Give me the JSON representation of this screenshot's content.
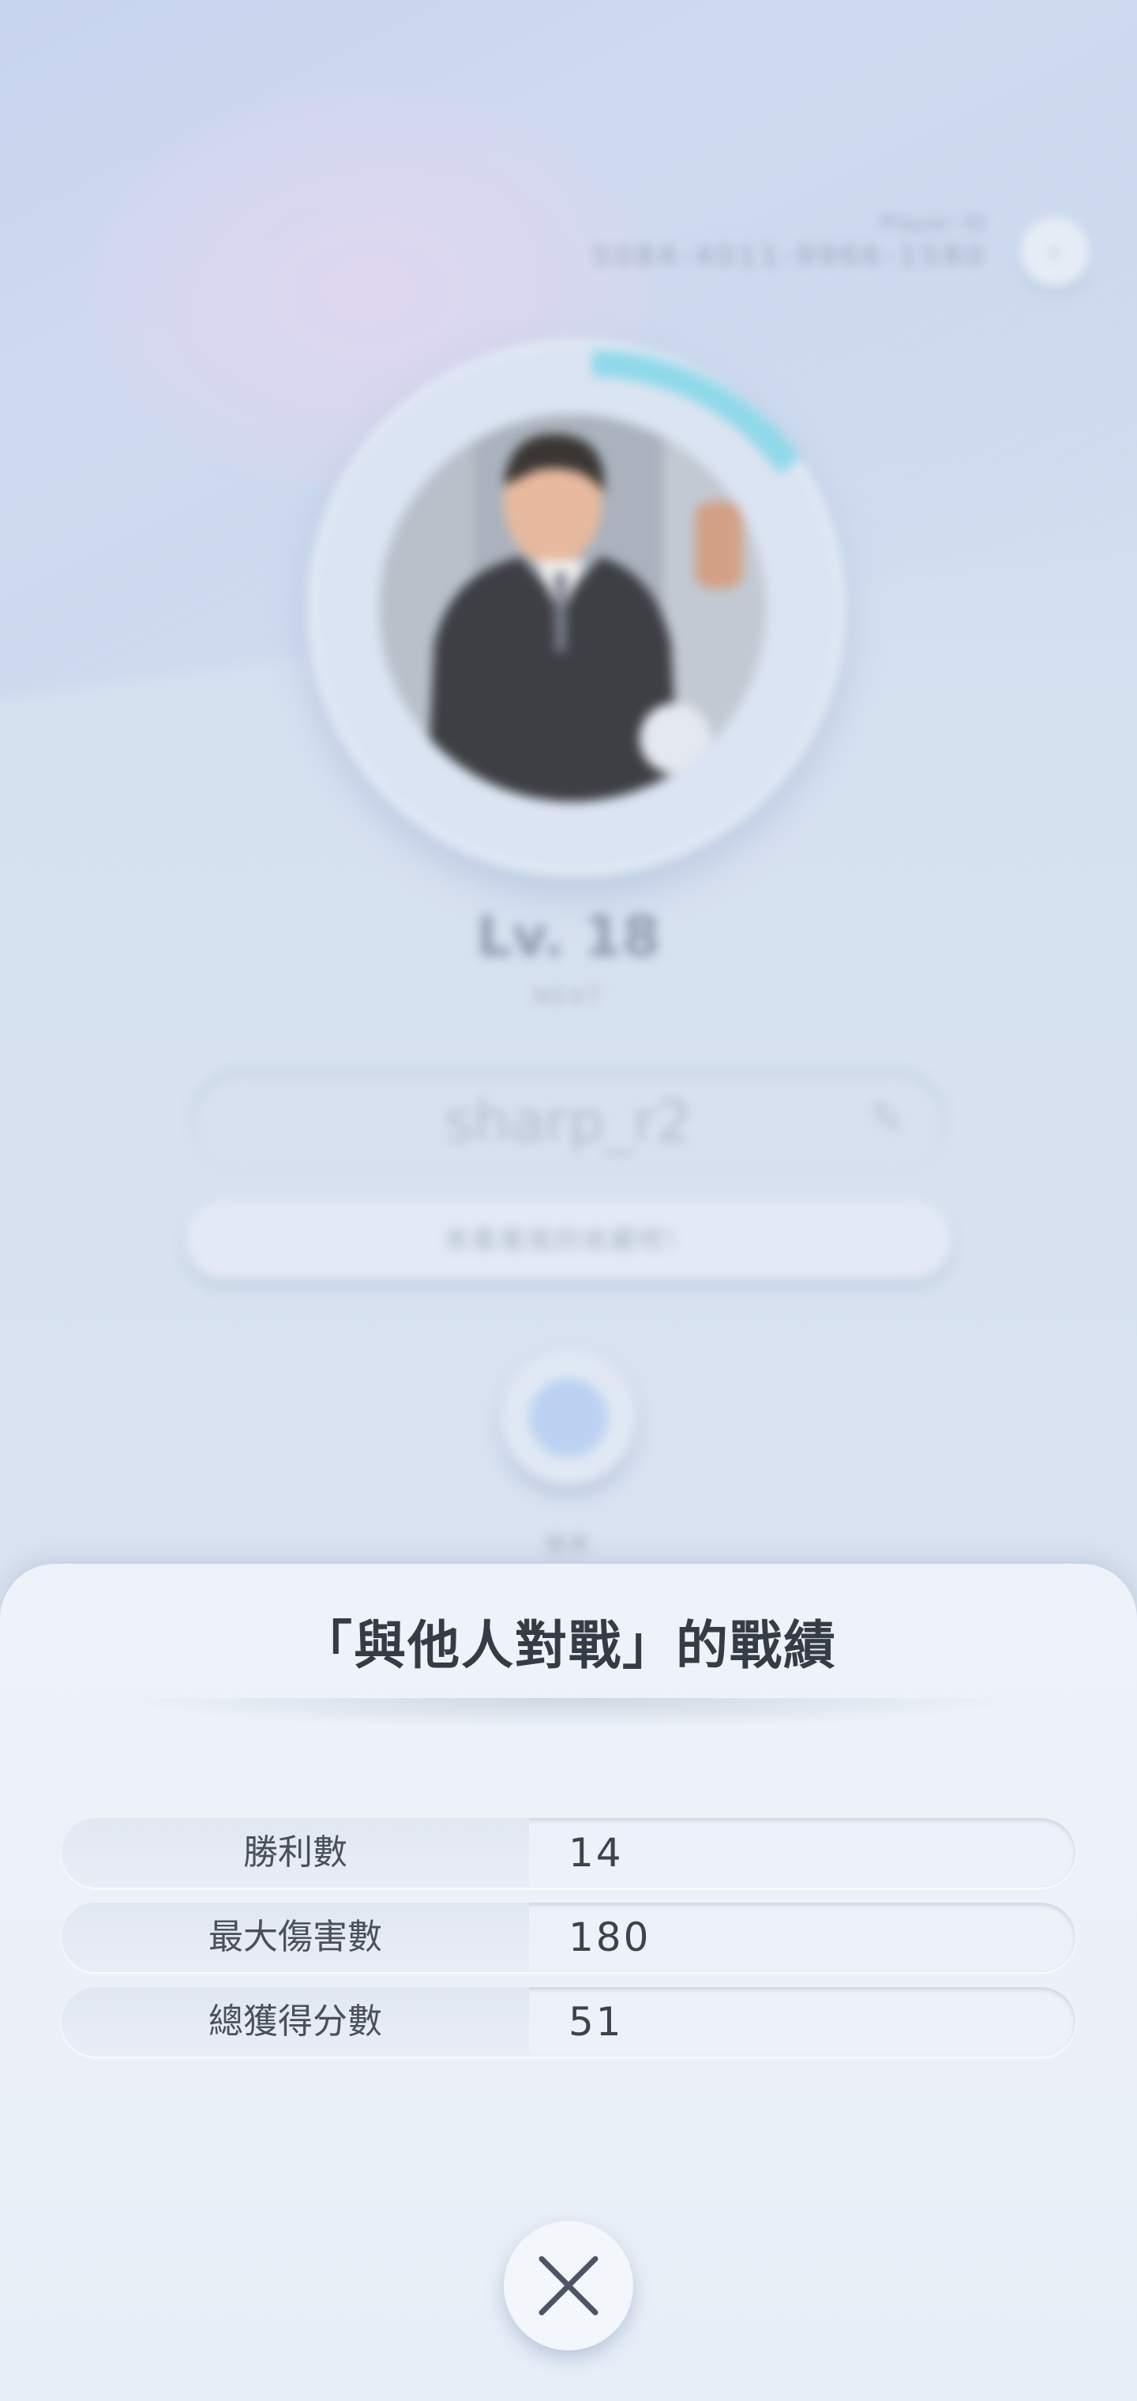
{
  "background": {
    "player_id_label": "Player ID",
    "player_id": "5084-4011-9966-1580",
    "level": "Lv. 18",
    "level_sub": "NEXT",
    "username": "sharp_r2",
    "message": "來看看我的收藏吧！",
    "badge_label": "徽章"
  },
  "modal": {
    "title": "「與他人對戰」的戰績",
    "stats": [
      {
        "label": "勝利數",
        "value": "14"
      },
      {
        "label": "最大傷害數",
        "value": "180"
      },
      {
        "label": "總獲得分數",
        "value": "51"
      }
    ]
  },
  "colors": {
    "ring_progress": "#8fd9ea",
    "sheet_bg": "#eef3f9",
    "title_text": "#363c46"
  }
}
